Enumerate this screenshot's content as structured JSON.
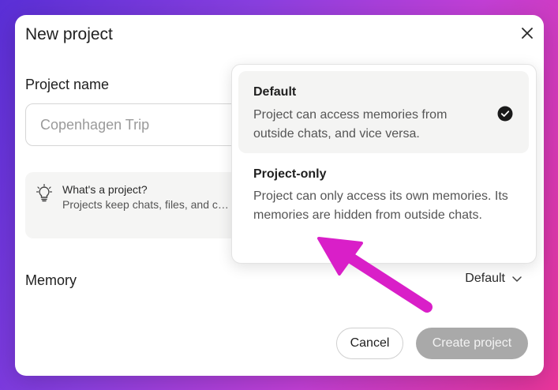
{
  "dialog": {
    "title": "New project",
    "close_icon": "close-icon"
  },
  "project_name": {
    "label": "Project name",
    "placeholder": "Copenhagen Trip",
    "value": ""
  },
  "info": {
    "icon": "lightbulb-icon",
    "title": "What's a project?",
    "body": "Projects keep chats, files, and c… ongoing work, or just to keep th…"
  },
  "memory": {
    "label": "Memory",
    "selected": "Default",
    "chevron_icon": "chevron-down-icon",
    "options": [
      {
        "title": "Default",
        "description": "Project can access memories from outside chats, and vice versa.",
        "selected": true
      },
      {
        "title": "Project-only",
        "description": "Project can only access its own memories. Its memories are hidden from outside chats.",
        "selected": false
      }
    ]
  },
  "buttons": {
    "cancel": "Cancel",
    "create": "Create project"
  },
  "colors": {
    "annotation_arrow": "#d91fc8",
    "create_disabled": "#a9a9a9"
  }
}
